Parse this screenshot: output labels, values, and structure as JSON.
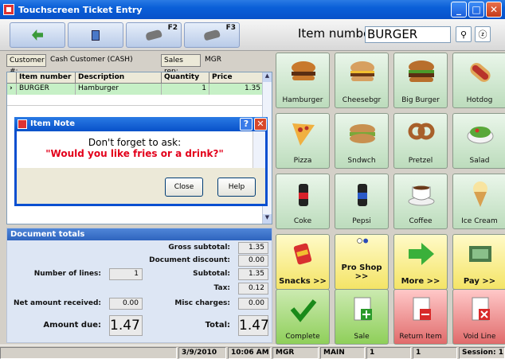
{
  "window": {
    "title": "Touchscreen Ticket Entry"
  },
  "toolbar": {
    "f2": "F2",
    "f3": "F3"
  },
  "item_entry": {
    "label": "Item number",
    "value": "BURGER"
  },
  "customer": {
    "label": "Customer #:",
    "value": "Cash Customer  (CASH)",
    "rep_label": "Sales rep:",
    "rep_value": "MGR"
  },
  "grid": {
    "headers": [
      "Item number",
      "Description",
      "Quantity",
      "Price"
    ],
    "row": {
      "item": "BURGER",
      "desc": "Hamburger",
      "qty": "1",
      "price": "1.35"
    }
  },
  "note_dialog": {
    "title": "Item Note",
    "line1": "Don't forget to ask:",
    "line2": "\"Would you like fries or a drink?\"",
    "close": "Close",
    "help": "Help"
  },
  "totals": {
    "header": "Document totals",
    "gross_label": "Gross subtotal:",
    "gross": "1.35",
    "disc_label": "Document discount:",
    "disc": "0.00",
    "lines_label": "Number of lines:",
    "lines": "1",
    "sub_label": "Subtotal:",
    "sub": "1.35",
    "tax_label": "Tax:",
    "tax": "0.12",
    "net_label": "Net amount received:",
    "net": "0.00",
    "misc_label": "Misc charges:",
    "misc": "0.00",
    "due_label": "Amount due:",
    "due": "1.47",
    "total_label": "Total:",
    "total": "1.47"
  },
  "tiles": [
    "Hamburger",
    "Cheesebgr",
    "Big Burger",
    "Hotdog",
    "Pizza",
    "Sndwch",
    "Pretzel",
    "Salad",
    "Coke",
    "Pepsi",
    "Coffee",
    "Ice Cream",
    "Snacks >>",
    "Pro Shop\n>>",
    "More >>",
    "Pay >>",
    "Complete",
    "Sale",
    "Return Item",
    "Void Line"
  ],
  "status": {
    "date": "3/9/2010",
    "time": "10:06 AM",
    "user": "MGR",
    "store": "MAIN",
    "a": "1",
    "b": "1",
    "session": "Session: 1"
  }
}
